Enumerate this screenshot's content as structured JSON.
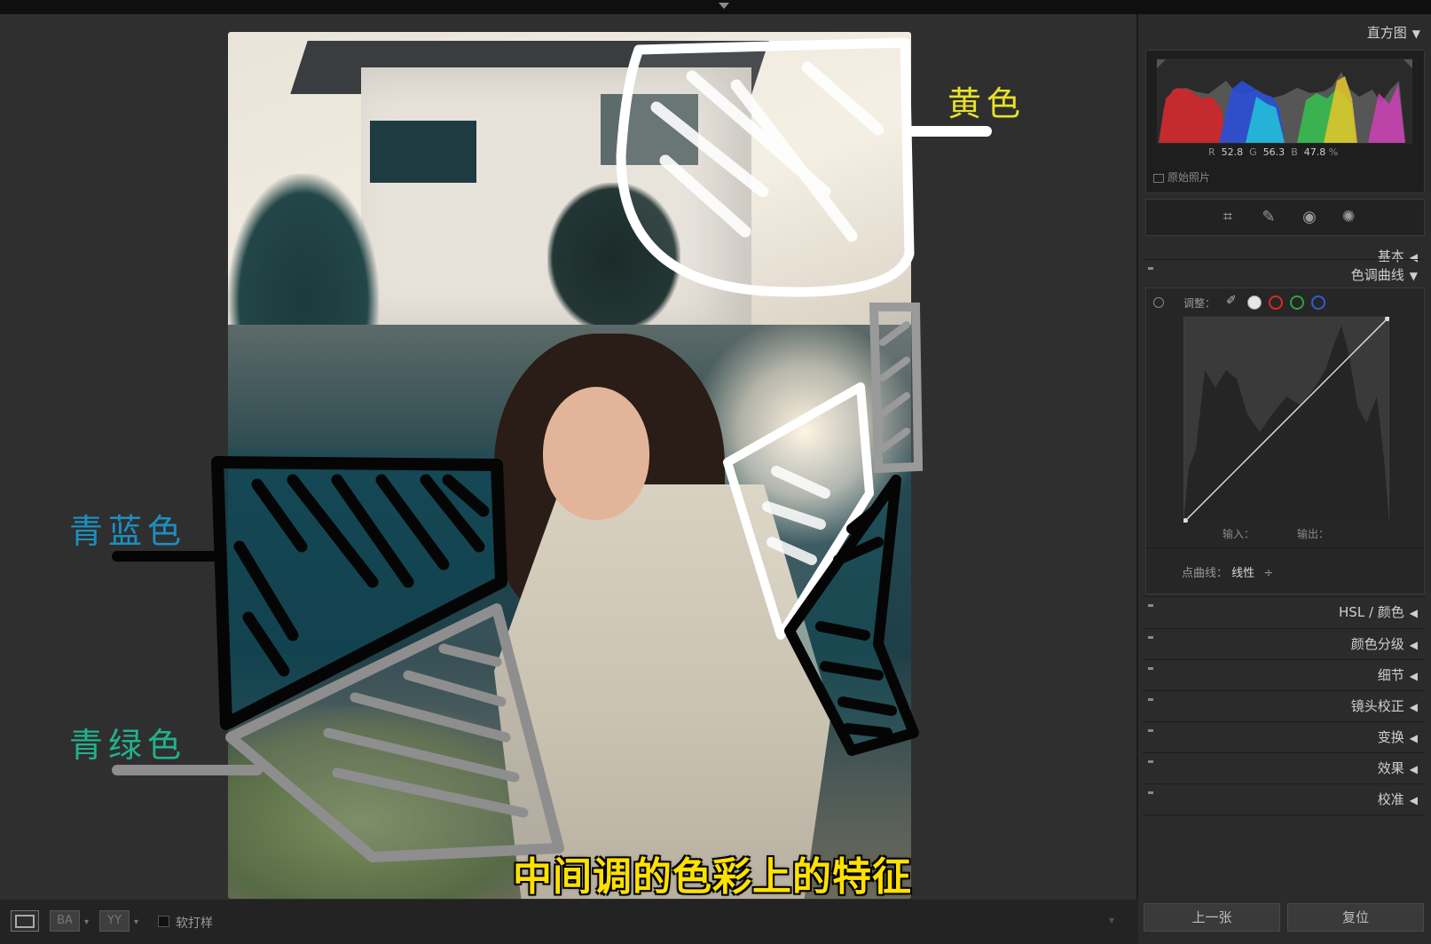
{
  "annotations": {
    "yellow_label": "黄色",
    "cyan_blue_label": "青蓝色",
    "cyan_green_label": "青绿色",
    "subtitle": "中间调的色彩上的特征"
  },
  "colors": {
    "yellow_label": "#e7e12a",
    "cyan_blue_label": "#1c8fc0",
    "cyan_green_label": "#21b28d",
    "subtitle": "#ffe100"
  },
  "toolbar_bottom": {
    "btn1": "",
    "btn2": "BA",
    "btn3": "YY",
    "soft_proof_label": "软打样"
  },
  "right_panel": {
    "histogram": {
      "title": "直方图",
      "r_label": "R",
      "r_value": "52.8",
      "g_label": "G",
      "g_value": "56.3",
      "b_label": "B",
      "b_value": "47.8",
      "percent": "%",
      "original_photo": "原始照片"
    },
    "tools": [
      "crop-icon",
      "spot-removal-icon",
      "red-eye-icon",
      "radial-filter-icon"
    ],
    "basic": "基本",
    "tone_curve": {
      "title": "色调曲线",
      "adjust_label": "调整：",
      "input_label": "输入：",
      "output_label": "输出：",
      "point_curve_label": "点曲线：",
      "point_curve_value": "线性",
      "point_curve_arrow": "÷"
    },
    "sections": [
      "HSL / 颜色",
      "颜色分级",
      "细节",
      "镜头校正",
      "变换",
      "效果",
      "校准"
    ],
    "prev_button": "上一张",
    "reset_button": "复位"
  }
}
